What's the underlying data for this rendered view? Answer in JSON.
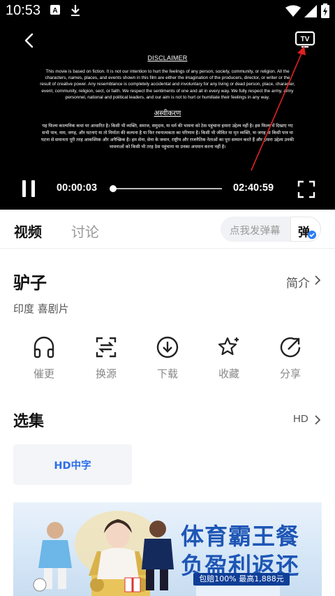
{
  "status_bar": {
    "time": "10:53",
    "icons": [
      "notification-a-icon",
      "download-icon",
      "wifi-icon",
      "signal-icon",
      "battery-charging-icon"
    ]
  },
  "player": {
    "disclaimer_title": "DISCLAIMER",
    "disclaimer_body": "This movie is based on fiction. It is not our intention to hurt the feelings of any person, society, community, or religion. All the characters, names, places, and events shown in this film are either the imagination of the producers, director, or writer or the result of creative power. Any resemblance is completely accidental and involuntary for any living or dead person, place, character, event, community, religion, sect, or faith. We respect the sentiments of one and all in every way. We fully respect the army, army personnel, national and political leaders, and our aim is not to hurt or humiliate their feelings in any way.",
    "disclaimer_hi_title": "अस्वीकरण",
    "disclaimer_hi_body": "यह फिल्म काल्पनिक कथा पर आधारित है। किसी भी व्यक्ति, समाज, समुदाय, या धर्म की भावना को ठेस पहुंचाना हमारा उद्देश्य नहीं है। इस फिल्म में दिखाए गए सभी पात्र, नाम, जगह, और घटनाएं या तो निर्माता की कल्पना है या फिर रचनात्मकता का परिणाम है। किसी भी जीवित या मृत व्यक्ति, या जगह या किसी पात्र या घटना से समानता पूरी तरह आकस्मिक और अनैच्छिक है। हम सेना, सेना के जवान, राष्ट्रीय और राजनैतिक नेताओं का पूरा सम्मान करते हैं और हमारा उद्देश्य उनकी भावनाओं को किसी भी तरह ठेस पहुंचाना या उनका अपमान करना नहीं है।",
    "current_time": "00:00:03",
    "total_time": "02:40:59",
    "progress": 0.0003
  },
  "tabs": {
    "video": "视频",
    "discuss": "讨论"
  },
  "danmu": {
    "placeholder": "点我发弹幕",
    "toggle_char": "弹"
  },
  "movie": {
    "title": "驴子",
    "intro": "简介",
    "tags": "印度  喜剧片"
  },
  "actions": [
    {
      "label": "催更",
      "icon": "headphones-icon"
    },
    {
      "label": "换源",
      "icon": "switch-source-icon"
    },
    {
      "label": "下载",
      "icon": "download-circle-icon"
    },
    {
      "label": "收藏",
      "icon": "star-icon"
    },
    {
      "label": "分享",
      "icon": "share-icon"
    }
  ],
  "episodes": {
    "title": "选集",
    "quality": "HD",
    "items": [
      "HD中字"
    ]
  },
  "ad": {
    "headline1": "体育霸王餐",
    "headline2": "负盈利返还",
    "subline": "包赔100% 最高1,888元"
  },
  "colors": {
    "accent": "#2b6fe8",
    "annotation_arrow": "#e02020"
  }
}
